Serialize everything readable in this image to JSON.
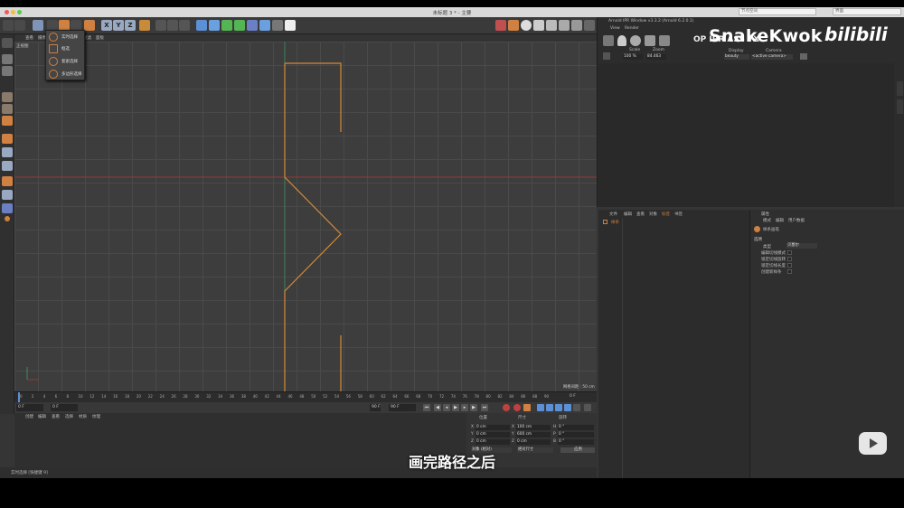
{
  "window": {
    "title": "未标题 3 * - 主要",
    "layout_input": "节点空间",
    "layout_select": "界面"
  },
  "viewport": {
    "menu": [
      "查看",
      "摄像机",
      "显示",
      "选项",
      "过滤",
      "面板"
    ],
    "view_name": "正视图",
    "grid_spacing": "网格间距 : 50 cm"
  },
  "selection_dropdown": {
    "items": [
      "实时选择",
      "框选",
      "套索选择",
      "多边形选择"
    ]
  },
  "timeline": {
    "ticks": [
      "0",
      "2",
      "4",
      "6",
      "8",
      "10",
      "12",
      "14",
      "16",
      "18",
      "20",
      "22",
      "24",
      "26",
      "28",
      "30",
      "32",
      "34",
      "36",
      "38",
      "40",
      "42",
      "44",
      "46",
      "48",
      "50",
      "52",
      "54",
      "56",
      "58",
      "60",
      "62",
      "64",
      "66",
      "68",
      "70",
      "72",
      "74",
      "76",
      "78",
      "80",
      "82",
      "84",
      "86",
      "88",
      "90"
    ],
    "end_label": "0 F"
  },
  "transport": {
    "start": "0 F",
    "current": "0 F",
    "end": "90 F",
    "max": "90 F"
  },
  "material_manager": {
    "menu": [
      "创建",
      "编辑",
      "查看",
      "选择",
      "材质",
      "纹理"
    ]
  },
  "coordinates": {
    "headers": [
      "位置",
      "尺寸",
      "旋转"
    ],
    "rows": [
      {
        "axis": "X",
        "pos": "0 cm",
        "size": "100 cm",
        "rot_axis": "H",
        "rot": "0 °"
      },
      {
        "axis": "Y",
        "pos": "0 cm",
        "size": "600 cm",
        "rot_axis": "P",
        "rot": "0 °"
      },
      {
        "axis": "Z",
        "pos": "0 cm",
        "size": "0 cm",
        "rot_axis": "B",
        "rot": "0 °"
      }
    ],
    "mode_select": "对象 (相对)",
    "size_select": "绝对尺寸",
    "apply_button": "应用"
  },
  "status_bar": {
    "text": "实时选择 [快捷键 9]"
  },
  "ipr": {
    "title": "Arnold IPR Window v3.3.2 (Arnold 6.2.0.1)",
    "menu": [
      "View",
      "Render"
    ],
    "scale_label": "Scale",
    "scale_value": "100 %",
    "zoom_label": "Zoom",
    "zoom_value": "84.463",
    "display_label": "Display",
    "display_value": "beauty",
    "camera_label": "Camera",
    "camera_value": "<active camera>",
    "toolbar_text": "OP  IPR  ASS  TX"
  },
  "object_manager": {
    "menu": [
      "文件",
      "编辑",
      "查看",
      "对象",
      "标签",
      "书签"
    ],
    "item": "样条"
  },
  "attribute_manager": {
    "title": "属性",
    "menu": [
      "模式",
      "编辑",
      "用户数据"
    ],
    "tool_name": "样条画笔",
    "section": "选项",
    "type_label": "类型",
    "type_value": "贝塞尔",
    "options": [
      "编辑切线模式",
      "锁定切线旋转",
      "锁定切线长度",
      "创建新样条"
    ]
  },
  "watermark": {
    "author": "SnakeKwok",
    "site": "bilibili"
  },
  "subtitle": "画完路径之后",
  "colors": {
    "accent": "#d08040",
    "xyz": "#9aa9c2",
    "spline": "#d48a35",
    "axis_red": "#b33535"
  }
}
